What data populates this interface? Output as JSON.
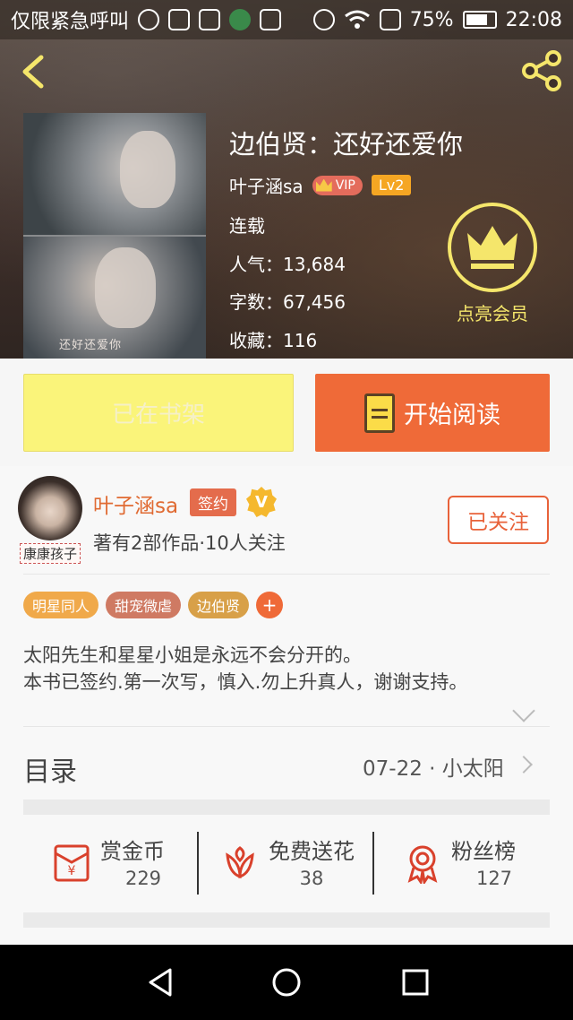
{
  "colors": {
    "accent": "#ef6a38",
    "shelf_yellow": "#faf47a",
    "member_yellow": "#f5e66b",
    "author_orange": "#e06a32"
  },
  "status_bar": {
    "notification_text": "仅限紧急呼叫",
    "battery": "75%",
    "time": "22:08",
    "icons": [
      "location-icon",
      "image-icon",
      "bell-icon",
      "app-icon",
      "android-icon",
      "alarm-icon",
      "wifi-icon",
      "sim-icon",
      "battery-icon"
    ]
  },
  "header": {
    "back_icon": "chevron-left-icon",
    "share_icon": "share-icon"
  },
  "book": {
    "title": "边伯贤：还好还爱你",
    "author": "叶子涵sa",
    "vip_badge": "VIP",
    "level_badge": "Lv2",
    "status": "连载",
    "popularity": "人气：13,684",
    "word_count": "字数：67,456",
    "favorites": "收藏：116",
    "cover_caption": "还好还爱你"
  },
  "member": {
    "label": "点亮会员",
    "icon": "crown-icon"
  },
  "actions": {
    "shelf_label": "已在书架",
    "read_label": "开始阅读",
    "read_icon": "book-icon"
  },
  "author_card": {
    "name": "叶子涵sa",
    "sign_badge": "签约",
    "verified_badge": "V",
    "stats": "著有2部作品·10人关注",
    "follow_label": "已关注",
    "avatar_tag": "康康孩子"
  },
  "tags": [
    {
      "label": "明星同人",
      "color": "#f0a94a"
    },
    {
      "label": "甜宠微虐",
      "color": "#cf7a63"
    },
    {
      "label": "边伯贤",
      "color": "#d8a048"
    },
    {
      "label": "+",
      "color": "#ef6a38"
    }
  ],
  "description": {
    "line1": "太阳先生和星星小姐是永远不会分开的。",
    "line2": "本书已签约.第一次写，慎入.勿上升真人，谢谢支持。"
  },
  "toc": {
    "label": "目录",
    "latest": "07-22 · 小太阳"
  },
  "stats": [
    {
      "label": "赏金币",
      "value": "229",
      "icon": "red-envelope-icon"
    },
    {
      "label": "免费送花",
      "value": "38",
      "icon": "flower-icon"
    },
    {
      "label": "粉丝榜",
      "value": "127",
      "icon": "medal-icon"
    }
  ],
  "nav_bar": {
    "icons": [
      "back-triangle-icon",
      "home-circle-icon",
      "recents-square-icon"
    ]
  }
}
